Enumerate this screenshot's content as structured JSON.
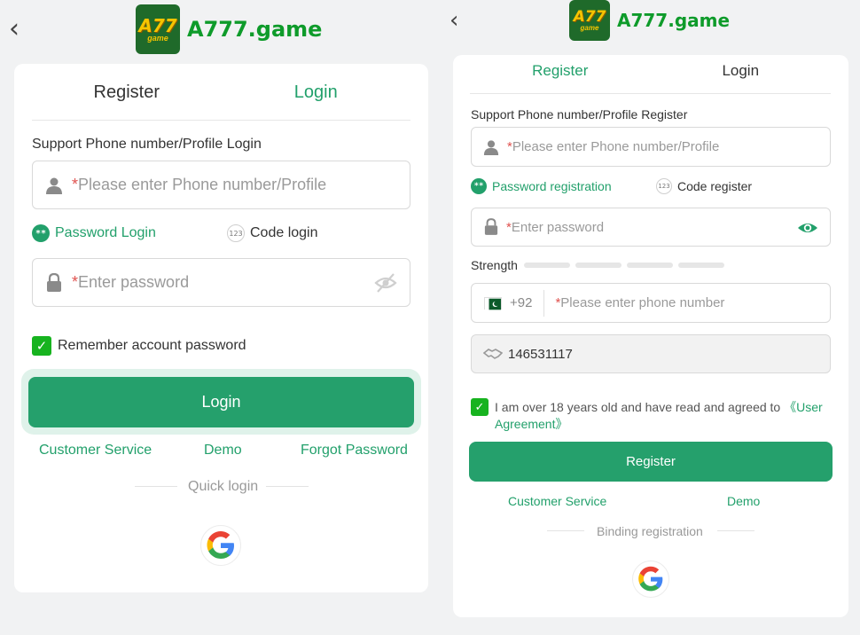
{
  "login_screen": {
    "logo": {
      "badge": "A77",
      "badge_sub": "game",
      "text": "A777.game"
    },
    "tabs": [
      {
        "label": "Register",
        "active": false
      },
      {
        "label": "Login",
        "active": true
      }
    ],
    "support_label": "Support Phone number/Profile Login",
    "username": {
      "required_mark": "*",
      "placeholder": "Please enter Phone number/Profile",
      "icon": "user-icon"
    },
    "method_password": "Password Login",
    "method_code": "Code login",
    "method_code_badge": "123",
    "method_password_badge": "**",
    "password": {
      "required_mark": "*",
      "placeholder": "Enter password",
      "icon": "lock-icon",
      "toggle_icon": "eye-off-icon"
    },
    "remember": {
      "label": "Remember account password",
      "checked": true
    },
    "submit_label": "Login",
    "links": {
      "customer_service": "Customer Service",
      "demo": "Demo",
      "forgot": "Forgot Password"
    },
    "quick_login_label": "Quick login",
    "social": "google-icon"
  },
  "register_screen": {
    "logo": {
      "badge": "A77",
      "badge_sub": "game",
      "text": "A777.game"
    },
    "tabs": [
      {
        "label": "Register",
        "active": true
      },
      {
        "label": "Login",
        "active": false
      }
    ],
    "support_label": "Support Phone number/Profile Register",
    "username": {
      "required_mark": "*",
      "placeholder": "Please enter Phone number/Profile",
      "icon": "user-icon"
    },
    "method_password": "Password registration",
    "method_code": "Code register",
    "method_code_badge": "123",
    "method_password_badge": "**",
    "password": {
      "required_mark": "*",
      "placeholder": "Enter password",
      "icon": "lock-icon",
      "toggle_icon": "eye-icon"
    },
    "strength_label": "Strength",
    "phone": {
      "country_code": "+92",
      "country_flag": "pakistan-flag-icon",
      "required_mark": "*",
      "placeholder": "Please enter phone number"
    },
    "invite_code": {
      "value": "146531117",
      "icon": "handshake-icon"
    },
    "agreement": {
      "text": "I am over 18 years old and have read and agreed to ",
      "link": "《User Agreement》",
      "checked": true
    },
    "submit_label": "Register",
    "links": {
      "customer_service": "Customer Service",
      "demo": "Demo"
    },
    "binding_label": "Binding registration",
    "social": "google-icon"
  },
  "colors": {
    "primary": "#25a06c",
    "link": "#22a06b",
    "check": "#17b31f",
    "required": "#e0524f",
    "logo_text": "#0e9b2a"
  }
}
